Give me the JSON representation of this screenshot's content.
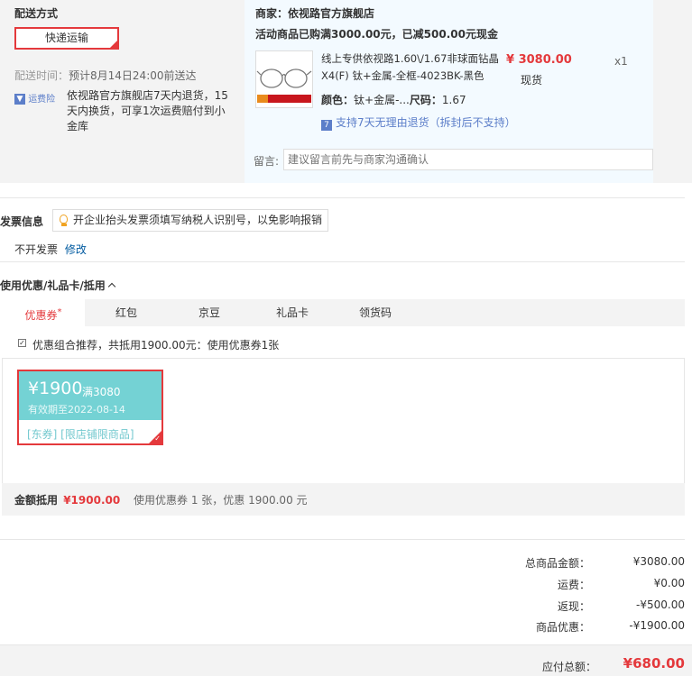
{
  "shipping": {
    "title": "配送方式",
    "method": "快递运输",
    "time_label": "配送时间：",
    "time_value": "预计8月14日24:00前送达",
    "insurance_badge": "运费险",
    "insurance_text": "依视路官方旗舰店7天内退货，15天内换货，可享1次运费赔付到小金库"
  },
  "order": {
    "seller": "商家：依视路官方旗舰店",
    "promo": "活动商品已购满3000.00元，已减500.00元现金",
    "product_name": "线上专供依视路1.60\\/1.67非球面钻晶X4(F) 钛+金属-全框-4023BK-黑色",
    "price": "¥ 3080.00",
    "stock": "现货",
    "qty": "x1",
    "color_label": "颜色：",
    "color_value": "钛+金属-...",
    "size_label": "尺码：",
    "size_value": "1.67",
    "return_policy": "支持7天无理由退货（拆封后不支持）",
    "message_label": "留言:",
    "message_placeholder": "建议留言前先与商家沟通确认"
  },
  "invoice": {
    "title": "发票信息",
    "tip": "开企业抬头发票须填写纳税人识别号，以免影响报销",
    "status": "不开发票",
    "edit": "修改"
  },
  "coupon": {
    "title": "使用优惠/礼品卡/抵用",
    "tabs": [
      "优惠券",
      "红包",
      "京豆",
      "礼品卡",
      "领货码"
    ],
    "tab_mark": "*",
    "combo_text": "优惠组合推荐，共抵用1900.00元：使用优惠券1张",
    "card": {
      "amount": "¥1900",
      "condition": "满3080",
      "expire": "有效期至2022-08-14",
      "tags": "[东券] [限店铺限商品]"
    },
    "deduct_label": "金额抵用",
    "deduct_value": "¥1900.00",
    "deduct_note": "使用优惠券 1 张，优惠 1900.00 元"
  },
  "summary": {
    "rows": [
      {
        "label": "总商品金额：",
        "value": "¥3080.00"
      },
      {
        "label": "运费：",
        "value": "¥0.00"
      },
      {
        "label": "返现：",
        "value": "-¥500.00"
      },
      {
        "label": "商品优惠：",
        "value": "-¥1900.00"
      }
    ],
    "total_label": "应付总额：",
    "total_value": "¥680.00"
  },
  "colors": {
    "accent": "#e4393c",
    "link": "#005aa0",
    "coupon_bg": "#74d2d4",
    "panel_bg": "#f3f3f3",
    "order_bg": "#f3faff"
  }
}
